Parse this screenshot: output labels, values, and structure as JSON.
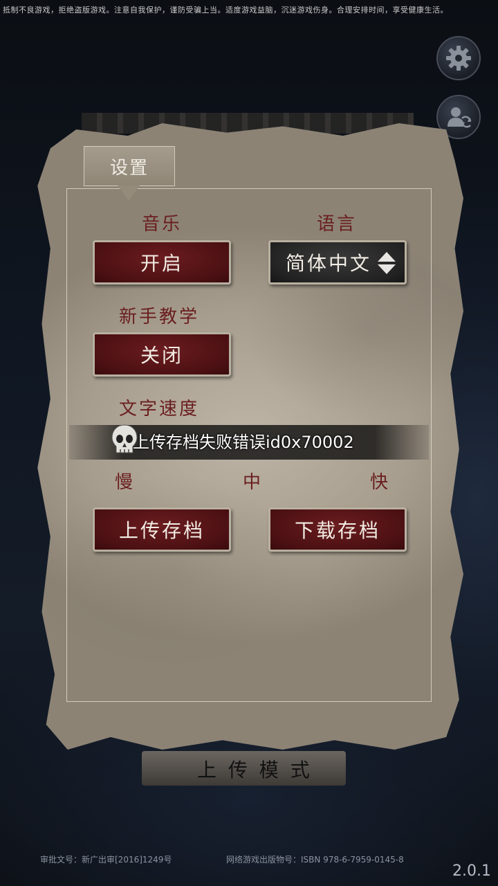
{
  "notice": "抵制不良游戏，拒绝盗版游戏。注意自我保护，谨防受骗上当。适度游戏益脑，沉迷游戏伤身。合理安排时间，享受健康生活。",
  "panel": {
    "tab_title": "设置",
    "music": {
      "label": "音乐",
      "value": "开启"
    },
    "language": {
      "label": "语言",
      "value": "简体中文"
    },
    "tutorial": {
      "label": "新手教学",
      "value": "关闭"
    },
    "text_speed": {
      "label": "文字速度",
      "options": [
        "慢",
        "中",
        "快"
      ]
    },
    "upload_button": "上传存档",
    "download_button": "下载存档"
  },
  "toast": "上传存档失败错误id0x70002",
  "background_banner": "上 传 模 式",
  "footer": {
    "approval": "审批文号：新广出审[2016]1249号",
    "isbn": "网络游戏出版物号：ISBN 978-6-7959-0145-8"
  },
  "version": "2.0.1",
  "icons": {
    "settings": "gear-icon",
    "account": "account-switch-icon",
    "toast": "skull-icon",
    "language_selector": "up-down-arrow-icon"
  },
  "colors": {
    "label_red": "#6a1e1e",
    "button_red": "#4b1013",
    "paper": "#a79d8e",
    "background": "#0d1118"
  }
}
